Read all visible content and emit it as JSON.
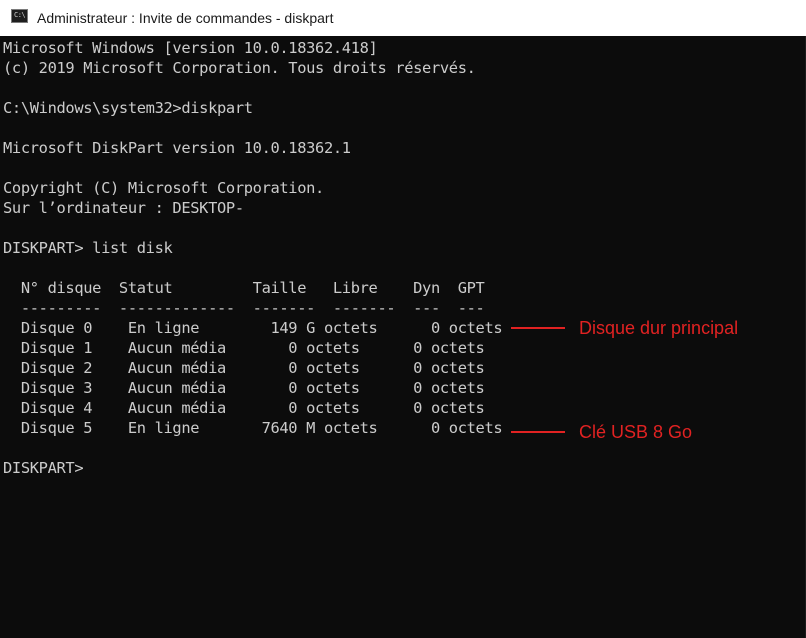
{
  "window": {
    "title": "Administrateur : Invite de commandes - diskpart",
    "icon_glyph": "C:\\",
    "icon_name": "cmd-icon"
  },
  "console": {
    "lines": [
      "Microsoft Windows [version 10.0.18362.418]",
      "(c) 2019 Microsoft Corporation. Tous droits réservés.",
      "",
      "C:\\Windows\\system32>diskpart",
      "",
      "Microsoft DiskPart version 10.0.18362.1",
      "",
      "Copyright (C) Microsoft Corporation.",
      "Sur l’ordinateur : DESKTOP-",
      "",
      "DISKPART> list disk",
      "",
      "  N° disque  Statut         Taille   Libre    Dyn  GPT",
      "  ---------  -------------  -------  -------  ---  ---",
      "  Disque 0    En ligne        149 G octets      0 octets",
      "  Disque 1    Aucun média       0 octets      0 octets",
      "  Disque 2    Aucun média       0 octets      0 octets",
      "  Disque 3    Aucun média       0 octets      0 octets",
      "  Disque 4    Aucun média       0 octets      0 octets",
      "  Disque 5    En ligne       7640 M octets      0 octets",
      "",
      "DISKPART>"
    ]
  },
  "annotations": {
    "disk0": "Disque dur principal",
    "disk5": "Clé USB  8 Go"
  },
  "colors": {
    "console_bg": "#0c0c0c",
    "console_text": "#cccccc",
    "annotation": "#e12222"
  }
}
